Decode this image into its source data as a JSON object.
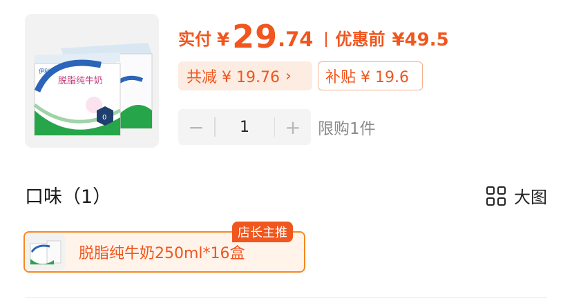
{
  "price": {
    "actual_label": "实付",
    "currency": "¥",
    "integer": "29",
    "decimal": ".74",
    "original_label": "优惠前",
    "original_price": "¥49.5"
  },
  "discount": {
    "total_label": "共减 ¥ 19.76",
    "chevron": "›",
    "subsidy_label": "补贴 ¥ 19.6"
  },
  "quantity": {
    "minus": "−",
    "value": "1",
    "plus": "+",
    "limit_text": "限购1件"
  },
  "flavor": {
    "title": "口味（1）",
    "view_toggle": "大图",
    "options": [
      {
        "label": "脱脂纯牛奶250ml*16盒",
        "tag": "店长主推",
        "selected": true
      }
    ]
  },
  "product_image": {
    "brand": "伊利",
    "product_name": "脱脂纯牛奶"
  },
  "colors": {
    "accent": "#f0561e",
    "accent_light": "#fdece2",
    "selected_border": "#f6891f",
    "muted_text": "#8a8a8a"
  }
}
